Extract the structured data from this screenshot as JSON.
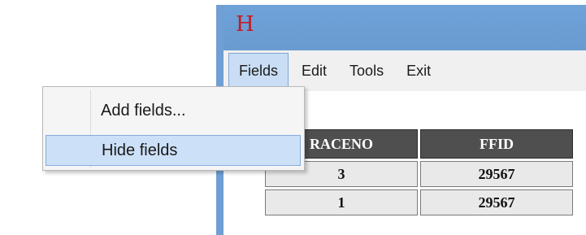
{
  "app": {
    "logo_text": "H",
    "logo_color": "#c8181e",
    "frame_color": "#6f9fd3"
  },
  "menubar": {
    "items": [
      {
        "label": "Fields",
        "open": true
      },
      {
        "label": "Edit"
      },
      {
        "label": "Tools"
      },
      {
        "label": "Exit"
      }
    ]
  },
  "fields_menu": {
    "items": [
      {
        "label": "Add fields..."
      },
      {
        "label": "Hide fields",
        "highlighted": true
      }
    ],
    "highlight_color": "#cce0f7"
  },
  "grid": {
    "columns": [
      "RACENO",
      "FFID"
    ],
    "rows": [
      [
        "3",
        "29567"
      ],
      [
        "1",
        "29567"
      ]
    ],
    "header_color": "#4f4f4f",
    "cell_color": "#e9e9e9"
  }
}
